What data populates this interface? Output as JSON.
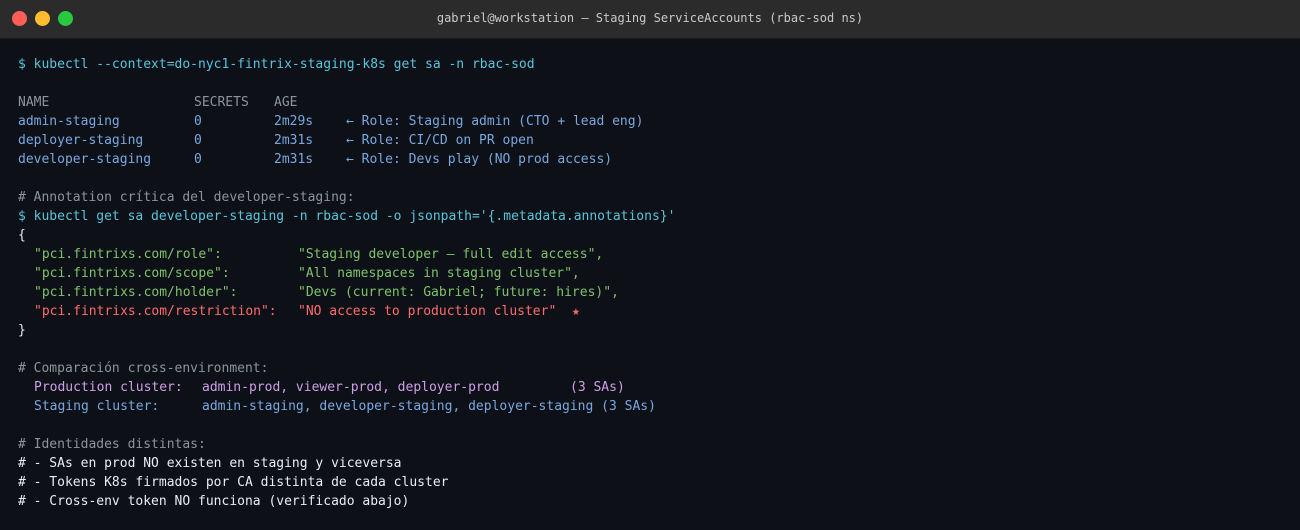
{
  "window": {
    "title": "gabriel@workstation — Staging ServiceAccounts (rbac-sod ns)"
  },
  "colors": {
    "command": "#58c4dc",
    "table_row": "#79a7e0",
    "comment": "#8b949e",
    "annotation_ok": "#7ec26b",
    "annotation_critical": "#ff6b6b",
    "production": "#d09ee8",
    "traffic_red": "#ff5f57",
    "traffic_yellow": "#febc2e",
    "traffic_green": "#28c840"
  },
  "terminal": {
    "cmd1": "$ kubectl --context=do-nyc1-fintrix-staging-k8s get sa -n rbac-sod",
    "table": {
      "headers": {
        "name": "NAME",
        "secrets": "SECRETS",
        "age": "AGE"
      },
      "rows": [
        {
          "name": "admin-staging",
          "secrets": "0",
          "age": "2m29s",
          "note": "← Role: Staging admin (CTO + lead eng)"
        },
        {
          "name": "deployer-staging",
          "secrets": "0",
          "age": "2m31s",
          "note": "← Role: CI/CD on PR open"
        },
        {
          "name": "developer-staging",
          "secrets": "0",
          "age": "2m31s",
          "note": "← Role: Devs play (NO prod access)"
        }
      ]
    },
    "comment_annotation": "# Annotation crítica del developer-staging:",
    "cmd2": "$ kubectl get sa developer-staging -n rbac-sod -o jsonpath='{.metadata.annotations}'",
    "brace_open": "{",
    "brace_close": "}",
    "annotations": [
      {
        "key": "\"pci.fintrixs.com/role\":",
        "value": "\"Staging developer — full edit access\","
      },
      {
        "key": "\"pci.fintrixs.com/scope\":",
        "value": "\"All namespaces in staging cluster\","
      },
      {
        "key": "\"pci.fintrixs.com/holder\":",
        "value": "\"Devs (current: Gabriel; future: hires)\","
      },
      {
        "key": "\"pci.fintrixs.com/restriction\":",
        "value": "\"NO access to production cluster\"",
        "marker": "★"
      }
    ],
    "comment_compare": "# Comparación cross-environment:",
    "production": {
      "label": "Production cluster:",
      "value": "admin-prod, viewer-prod, deployer-prod",
      "count": "(3 SAs)"
    },
    "staging": {
      "label": "Staging cluster:",
      "value": "admin-staging, developer-staging, deployer-staging",
      "count": "(3 SAs)"
    },
    "comment_identities": "# Identidades distintas:",
    "notes": [
      "# - SAs en prod NO existen en staging y viceversa",
      "# - Tokens K8s firmados por CA distinta de cada cluster",
      "# - Cross-env token NO funciona (verificado abajo)"
    ]
  }
}
